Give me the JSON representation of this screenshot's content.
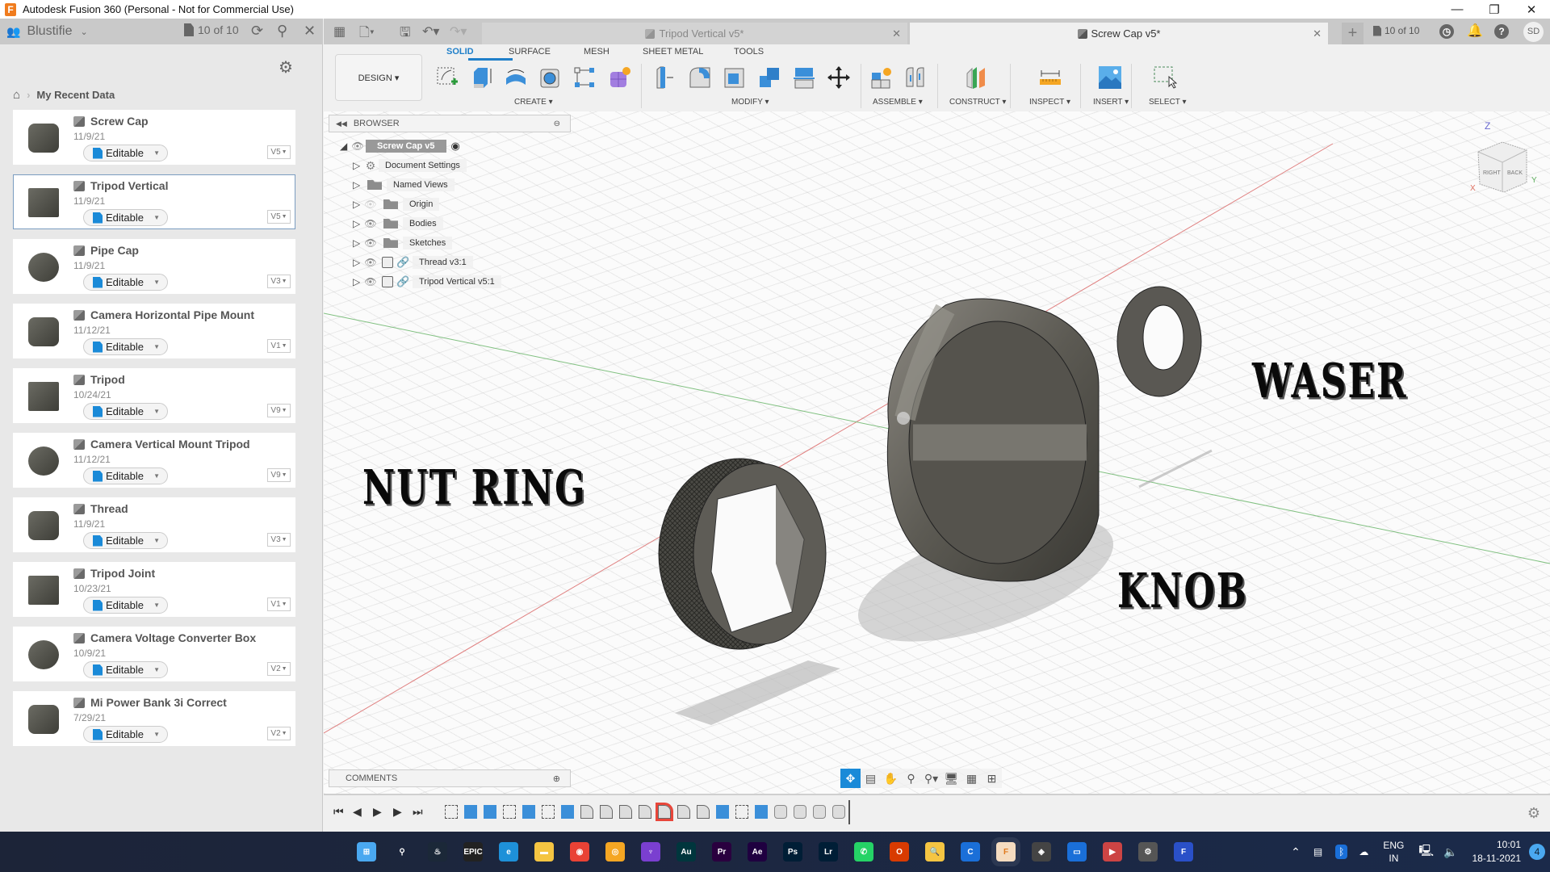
{
  "window": {
    "title": "Autodesk Fusion 360 (Personal - Not for Commercial Use)",
    "minimize": "—",
    "maximize": "❐",
    "close": "✕"
  },
  "data_panel": {
    "team": "Blustifie",
    "job_count": "10 of 10",
    "breadcrumb": "My Recent Data",
    "files": [
      {
        "name": "Screw Cap",
        "date": "11/9/21",
        "status": "Editable",
        "version": "V5",
        "selected": false
      },
      {
        "name": "Tripod Vertical",
        "date": "11/9/21",
        "status": "Editable",
        "version": "V5",
        "selected": true
      },
      {
        "name": "Pipe Cap",
        "date": "11/9/21",
        "status": "Editable",
        "version": "V3",
        "selected": false
      },
      {
        "name": "Camera Horizontal Pipe Mount",
        "date": "11/12/21",
        "status": "Editable",
        "version": "V1",
        "selected": false
      },
      {
        "name": "Tripod",
        "date": "10/24/21",
        "status": "Editable",
        "version": "V9",
        "selected": false
      },
      {
        "name": "Camera Vertical Mount Tripod",
        "date": "11/12/21",
        "status": "Editable",
        "version": "V9",
        "selected": false
      },
      {
        "name": "Thread",
        "date": "11/9/21",
        "status": "Editable",
        "version": "V3",
        "selected": false
      },
      {
        "name": "Tripod Joint",
        "date": "10/23/21",
        "status": "Editable",
        "version": "V1",
        "selected": false
      },
      {
        "name": "Camera Voltage Converter Box",
        "date": "10/9/21",
        "status": "Editable",
        "version": "V2",
        "selected": false
      },
      {
        "name": "Mi Power Bank 3i Correct",
        "date": "7/29/21",
        "status": "Editable",
        "version": "V2",
        "selected": false
      }
    ]
  },
  "doc_tabs": [
    {
      "label": "Tripod Vertical v5*",
      "active": false
    },
    {
      "label": "Screw Cap v5*",
      "active": true
    }
  ],
  "top_right": {
    "job_count": "10 of 10",
    "user_initials": "SD"
  },
  "ribbon": {
    "workspace": "DESIGN ▾",
    "tabs": [
      "SOLID",
      "SURFACE",
      "MESH",
      "SHEET METAL",
      "TOOLS"
    ],
    "active_tab": "SOLID",
    "groups": [
      "CREATE ▾",
      "MODIFY ▾",
      "ASSEMBLE ▾",
      "CONSTRUCT ▾",
      "INSPECT ▾",
      "INSERT ▾",
      "SELECT ▾"
    ]
  },
  "browser": {
    "title": "BROWSER",
    "root": "Screw Cap v5",
    "items": [
      {
        "label": "Document Settings",
        "icon": "gear-icon"
      },
      {
        "label": "Named Views",
        "icon": "folder-icon"
      },
      {
        "label": "Origin",
        "icon": "folder-icon",
        "hidden": true
      },
      {
        "label": "Bodies",
        "icon": "folder-icon"
      },
      {
        "label": "Sketches",
        "icon": "folder-icon"
      },
      {
        "label": "Thread v3:1",
        "icon": "component-link-icon"
      },
      {
        "label": "Tripod Vertical v5:1",
        "icon": "component-link-icon"
      }
    ]
  },
  "viewport": {
    "labels": {
      "nut_ring": "NUT RING",
      "waser": "WASER",
      "knob": "KNOB"
    },
    "viewcube": {
      "z": "Z",
      "x": "X",
      "y": "Y",
      "right": "RIGHT",
      "back": "BACK"
    }
  },
  "comments": {
    "title": "COMMENTS"
  },
  "timeline": {
    "feature_count": 21,
    "active_index": 11
  },
  "taskbar": {
    "apps": [
      "Start",
      "Search",
      "Steam",
      "Epic Games",
      "Edge",
      "File Explorer",
      "Chrome",
      "Canary",
      "Affinity",
      "Au",
      "Pr",
      "Ae",
      "Ps",
      "Lr",
      "WhatsApp",
      "Office",
      "Search Files",
      "CCleaner",
      "Fusion 360",
      "Game",
      "Photos",
      "Media",
      "Settings",
      "Frame"
    ],
    "language": "ENG",
    "region": "IN",
    "time": "10:01",
    "date": "18-11-2021",
    "notifications": "4"
  }
}
